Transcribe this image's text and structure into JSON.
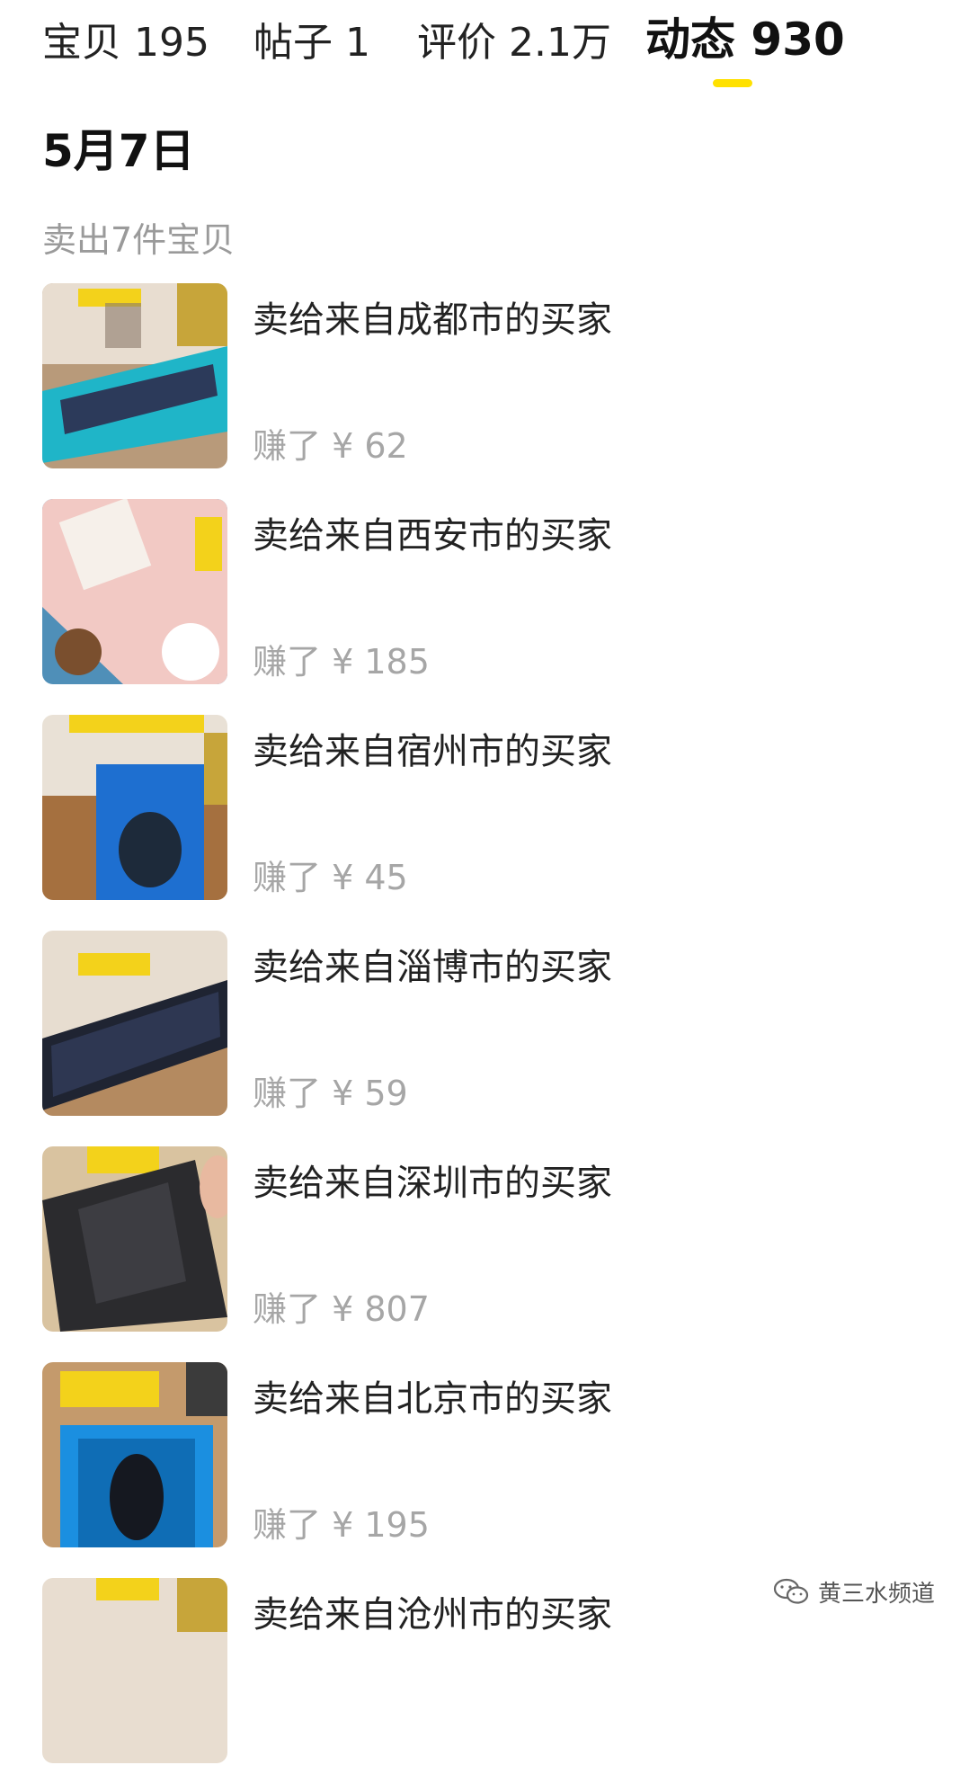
{
  "tabs": [
    {
      "label": "宝贝 195",
      "active": false
    },
    {
      "label": "帖子 1",
      "active": false
    },
    {
      "label": "评价 2.1万",
      "active": false
    },
    {
      "label": "动态 930",
      "active": true
    }
  ],
  "accent_color": "#ffe100",
  "section": {
    "date": "5月7日",
    "summary": "卖出7件宝贝"
  },
  "items": [
    {
      "title": "卖给来自成都市的买家",
      "earned": "赚了 ¥ 62",
      "thumb_icon": "keyboard-box-photo"
    },
    {
      "title": "卖给来自西安市的买家",
      "earned": "赚了 ¥ 185",
      "thumb_icon": "line-friends-keyboard-photo"
    },
    {
      "title": "卖给来自宿州市的买家",
      "earned": "赚了 ¥ 45",
      "thumb_icon": "mouse-box-photo"
    },
    {
      "title": "卖给来自淄博市的买家",
      "earned": "赚了 ¥ 59",
      "thumb_icon": "black-keyboard-photo"
    },
    {
      "title": "卖给来自深圳市的买家",
      "earned": "赚了 ¥ 807",
      "thumb_icon": "wrapped-package-photo"
    },
    {
      "title": "卖给来自北京市的买家",
      "earned": "赚了 ¥ 195",
      "thumb_icon": "gaming-mouse-photo"
    },
    {
      "title": "卖给来自沧州市的买家",
      "earned": "",
      "thumb_icon": "product-photo"
    }
  ],
  "watermark": {
    "text": "黄三水频道",
    "icon": "wechat-icon"
  }
}
